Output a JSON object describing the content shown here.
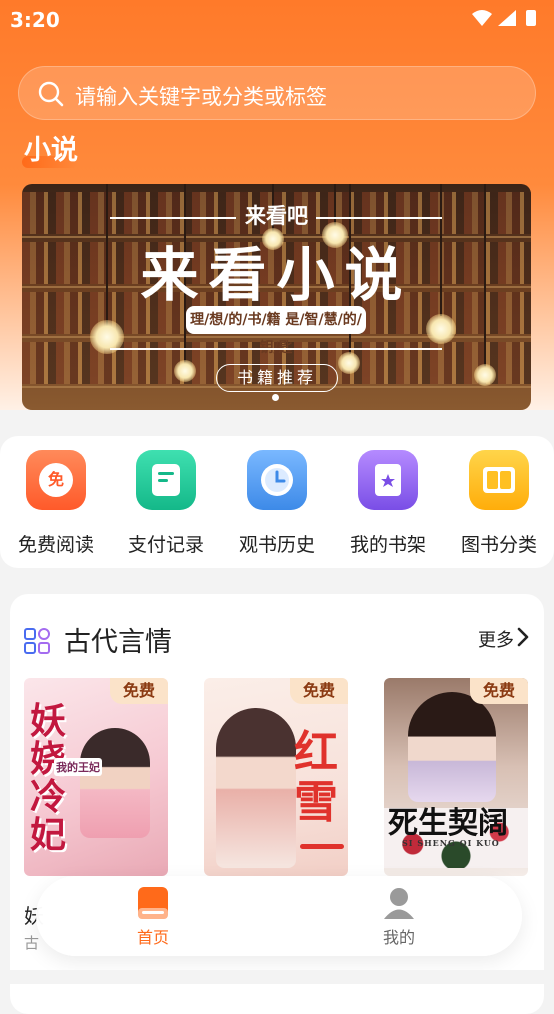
{
  "status_bar": {
    "time": "3:20"
  },
  "search": {
    "placeholder": "请输入关键字或分类或标签"
  },
  "header": {
    "section_title": "小说"
  },
  "banner": {
    "subtitle": "来看吧",
    "title": "来看小说",
    "tagline": "理/想/的/书/籍 是/智/慧/的/钥/匙",
    "button_label": "书籍推荐"
  },
  "quick_actions": [
    {
      "label": "免费阅读",
      "icon": "free-read-icon",
      "color": "#ff6a3d",
      "badge": "免"
    },
    {
      "label": "支付记录",
      "icon": "payment-record-icon",
      "color": "#20c997"
    },
    {
      "label": "观书历史",
      "icon": "history-clock-icon",
      "color": "#4a90e2"
    },
    {
      "label": "我的书架",
      "icon": "bookshelf-icon",
      "color": "#8e5df0"
    },
    {
      "label": "图书分类",
      "icon": "book-category-icon",
      "color": "#ffc021"
    }
  ],
  "category": {
    "title": "古代言情",
    "more_label": "更多",
    "books": [
      {
        "badge": "免费",
        "cover_text": "妖娆冷妃",
        "cover_sub": "我的王妃",
        "title_peek": "妖",
        "meta_peek": "古"
      },
      {
        "badge": "免费",
        "cover_text": "红雪"
      },
      {
        "badge": "免费",
        "cover_text": "死生契阔",
        "cover_sub": "SI SHENG QI KUO"
      }
    ]
  },
  "tabbar": {
    "tabs": [
      {
        "label": "首页",
        "icon": "home-book-icon",
        "active": true
      },
      {
        "label": "我的",
        "icon": "profile-icon",
        "active": false
      }
    ]
  },
  "colors": {
    "accent": "#ff7a2a",
    "active_tab": "#ff6a1a"
  }
}
